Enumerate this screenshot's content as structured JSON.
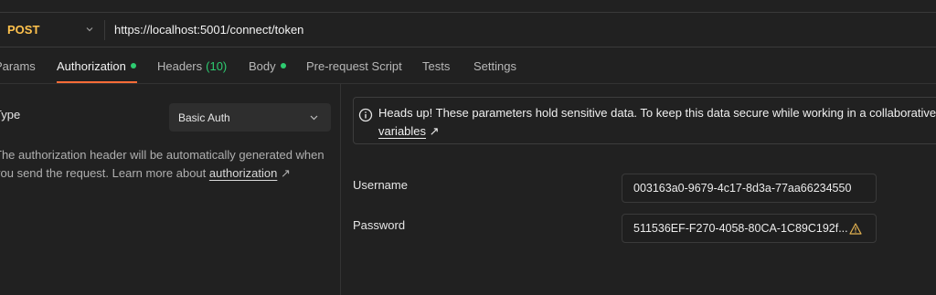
{
  "request": {
    "method": "POST",
    "url": "https://localhost:5001/connect/token"
  },
  "tabs": [
    {
      "label": "Params"
    },
    {
      "label": "Authorization",
      "active": true,
      "has_dot": true
    },
    {
      "label": "Headers",
      "count": "(10)"
    },
    {
      "label": "Body",
      "has_dot": true
    },
    {
      "label": "Pre-request Script"
    },
    {
      "label": "Tests"
    },
    {
      "label": "Settings"
    }
  ],
  "auth": {
    "type_label": "Type",
    "type_value": "Basic Auth",
    "help_line1": "The authorization header will be automatically generated when",
    "help_line2": "you send the request. Learn more about",
    "help_link": "authorization",
    "link_arrow": "↗"
  },
  "notice": {
    "text": "Heads up! These parameters hold sensitive data. To keep this data secure while working in a collaborative en",
    "link": "variables",
    "link_arrow": "↗"
  },
  "fields": {
    "username_label": "Username",
    "username_value": "003163a0-9679-4c17-8d3a-77aa66234550",
    "password_label": "Password",
    "password_value": "511536EF-F270-4058-80CA-1C89C192f..."
  },
  "colors": {
    "accent": "#ff6c37",
    "method": "#ffc24d",
    "status_dot": "#2ecc71",
    "background": "#212121"
  }
}
